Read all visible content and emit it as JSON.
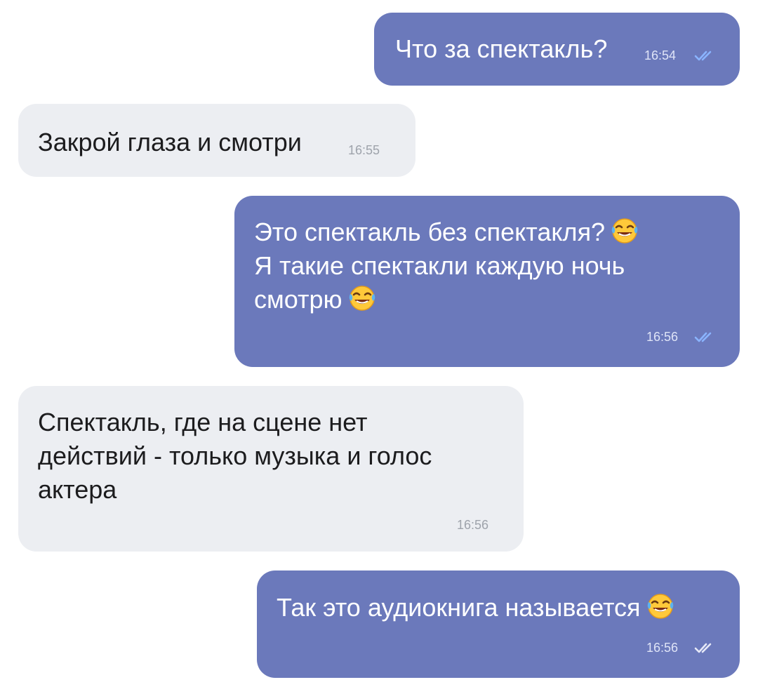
{
  "messages": [
    {
      "direction": "outgoing",
      "lines": [
        "Что за спектакль?"
      ],
      "time": "16:54",
      "status_icon": "double-check-icon"
    },
    {
      "direction": "incoming",
      "lines": [
        "Закрой глаза и смотри"
      ],
      "time": "16:55"
    },
    {
      "direction": "outgoing",
      "lines": [
        "Это спектакль без спектакля?",
        "Я такие спектакли каждую ночь",
        "смотрю"
      ],
      "emoji": "face-with-tears-of-joy-icon",
      "time": "16:56",
      "status_icon": "double-check-icon"
    },
    {
      "direction": "incoming",
      "lines": [
        "Спектакль, где на сцене нет",
        "действий - только музыка и голос",
        "актера"
      ],
      "time": "16:56"
    },
    {
      "direction": "outgoing",
      "lines": [
        "Так это аудиокнига называется"
      ],
      "emoji": "face-with-tears-of-joy-icon",
      "time": "16:56",
      "status_icon": "double-check-icon"
    }
  ],
  "colors": {
    "outgoing_bubble": "#6b79bb",
    "incoming_bubble": "#eceef2",
    "read_ticks": "#8ab4ff"
  }
}
